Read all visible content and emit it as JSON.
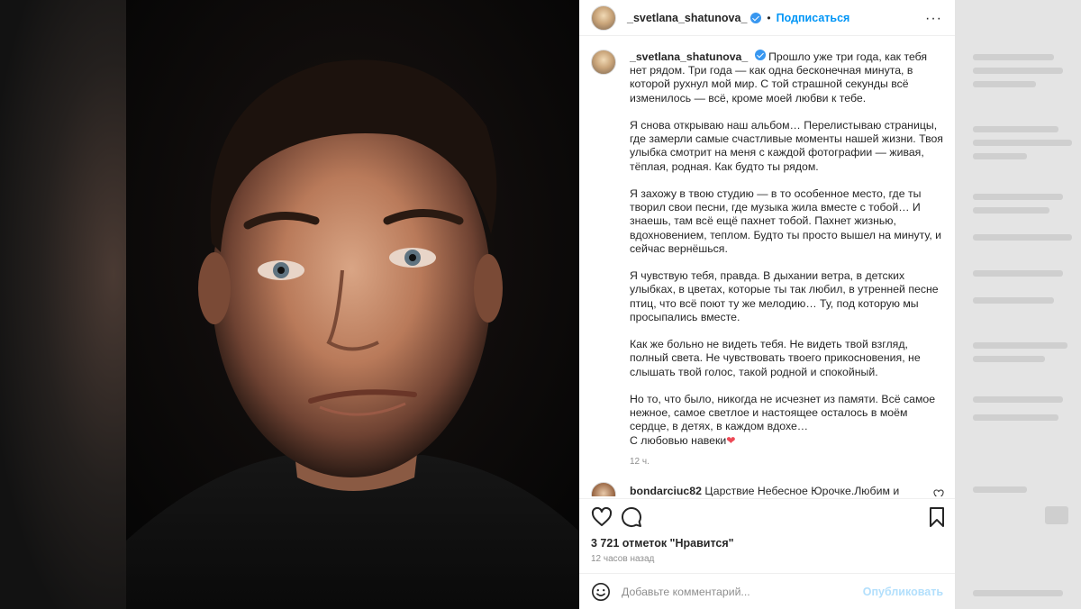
{
  "post": {
    "author": "_svetlana_shatunova_",
    "follow_label": "Подписаться",
    "separator": "•",
    "more_label": "···",
    "caption": {
      "username": "_svetlana_shatunova_",
      "paragraphs": [
        "Прошло уже три года, как тебя нет рядом. Три года — как одна бесконечная минута, в которой рухнул мой мир. С той страшной секунды всё изменилось — всё, кроме моей любви к тебе.",
        "Я снова открываю наш альбом… Перелистываю страницы, где замерли самые счастливые моменты нашей жизни. Твоя улыбка смотрит на меня с каждой фотографии — живая, тёплая, родная. Как будто ты рядом.",
        "Я захожу в твою студию — в то особенное место, где ты творил свои песни, где музыка жила вместе с тобой… И знаешь, там всё ещё пахнет тобой. Пахнет жизнью, вдохновением, теплом. Будто ты просто вышел на минуту, и сейчас вернёшься.",
        "Я чувствую тебя, правда. В дыхании ветра, в детских улыбках, в цветах, которые ты так любил, в утренней песне птиц, что всё поют ту же мелодию… Ту, под которую мы просыпались вместе.",
        "Как же больно не видеть тебя. Не видеть твой взгляд, полный света. Не чувствовать твоего прикосновения, не слышать твой голос, такой родной и спокойный."
      ],
      "last_paragraph": "Но то, что было, никогда не исчезнет из памяти. Всё самое нежное, самое светлое и настоящее осталось в моём сердце, в детях, в каждом вдохе…",
      "sign_off": "С любовью навеки",
      "heart": "❤",
      "time": "12 ч."
    },
    "comment": {
      "username": "bondarciuc82",
      "text": "Царствие Небесное Юрочке.Любим и"
    },
    "likes": "3 721 отметок \"Нравится\"",
    "posted": "12 часов назад",
    "add_comment": {
      "placeholder": "Добавьте комментарий...",
      "publish_label": "Опубликовать"
    }
  },
  "colors": {
    "accent": "#0095f6",
    "verified": "#3897f0",
    "heart": "#ed4956",
    "muted": "#8e8e8e",
    "publish_disabled": "#b2dffc"
  },
  "icons": [
    "verified-badge-icon",
    "more-options-icon",
    "heart-icon",
    "comment-icon",
    "bookmark-icon",
    "emoji-icon",
    "small-heart-icon"
  ]
}
